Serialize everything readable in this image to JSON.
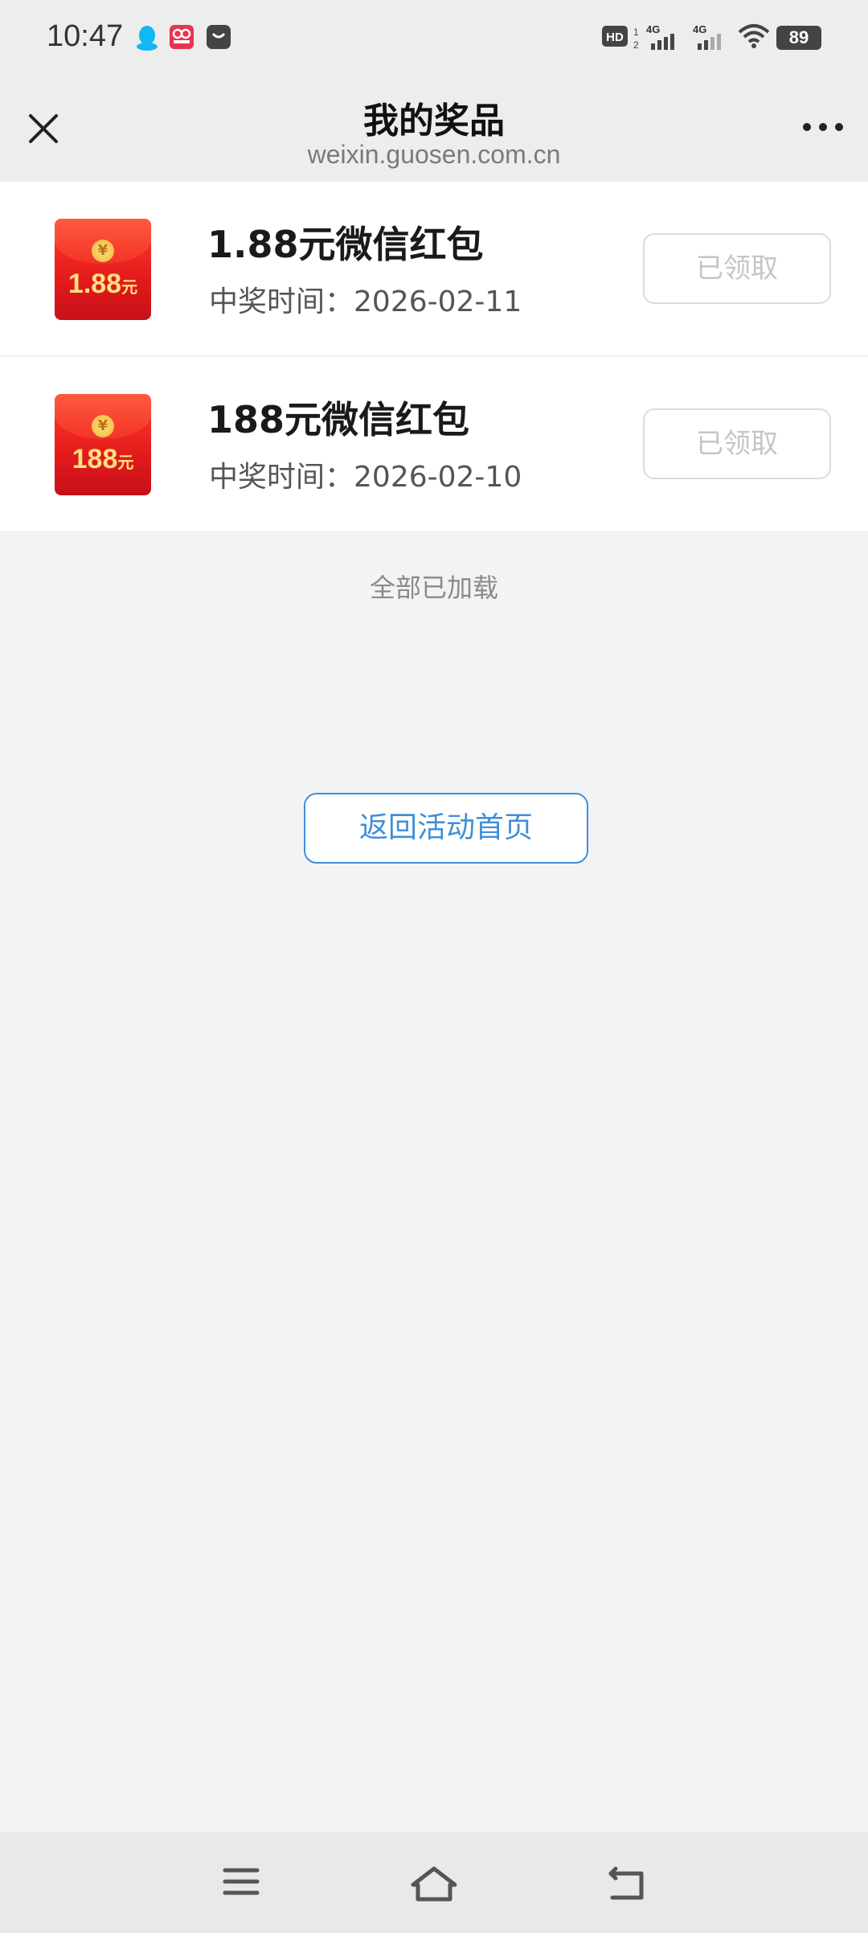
{
  "status_bar": {
    "time": "10:47",
    "battery": "89",
    "network1": "4G",
    "network2": "4G"
  },
  "header": {
    "title": "我的奖品",
    "domain": "weixin.guosen.com.cn"
  },
  "prizes": [
    {
      "title": "1.88元微信红包",
      "date_label": "中奖时间：",
      "date": "2026-02-11",
      "thumb_amount": "1.88",
      "thumb_unit": "元",
      "button": "已领取"
    },
    {
      "title": "188元微信红包",
      "date_label": "中奖时间：",
      "date": "2026-02-10",
      "thumb_amount": "188",
      "thumb_unit": "元",
      "button": "已领取"
    }
  ],
  "footer_text": "全部已加载",
  "back_button": "返回活动首页",
  "colors": {
    "accent": "#3f8fd8",
    "redpacket": "#e31b1b"
  }
}
